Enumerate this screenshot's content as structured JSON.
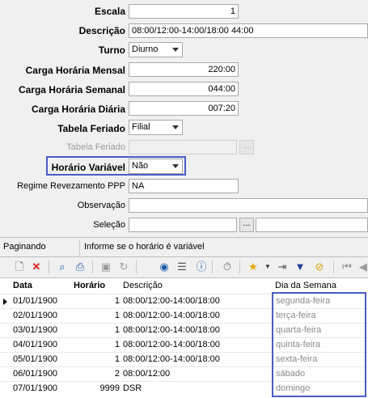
{
  "form": {
    "escala": {
      "label": "Escala",
      "value": "1"
    },
    "descricao": {
      "label": "Descrição",
      "value": "08:00/12:00-14:00/18:00  44:00"
    },
    "turno": {
      "label": "Turno",
      "value": "Diurno"
    },
    "carga_mensal": {
      "label": "Carga Horária Mensal",
      "value": "220:00"
    },
    "carga_semanal": {
      "label": "Carga Horária Semanal",
      "value": "044:00"
    },
    "carga_diaria": {
      "label": "Carga Horária Diária",
      "value": "007:20"
    },
    "tabela_feriado": {
      "label": "Tabela Feriado",
      "value": "Filial"
    },
    "tabela_feriado_2": {
      "label": "Tabela Feriado",
      "value": "",
      "button": "..."
    },
    "horario_variavel": {
      "label": "Horário Variável",
      "value": "Não"
    },
    "regime": {
      "label": "Regime Revezamento PPP",
      "value": "NA"
    },
    "observacao": {
      "label": "Observação",
      "value": ""
    },
    "selecao": {
      "label": "Seleção",
      "value": "",
      "button": "..."
    }
  },
  "status": {
    "left": "Paginando",
    "right": "Informe se o horário é variável"
  },
  "grid": {
    "columns": [
      "Data",
      "Horário",
      "Descrição",
      "Dia da Semana"
    ],
    "rows": [
      {
        "data": "01/01/1900",
        "horario": "1",
        "descricao": "08:00/12:00-14:00/18:00",
        "dia": "segunda-feira"
      },
      {
        "data": "02/01/1900",
        "horario": "1",
        "descricao": "08:00/12:00-14:00/18:00",
        "dia": "terça-feira"
      },
      {
        "data": "03/01/1900",
        "horario": "1",
        "descricao": "08:00/12:00-14:00/18:00",
        "dia": "quarta-feira"
      },
      {
        "data": "04/01/1900",
        "horario": "1",
        "descricao": "08:00/12:00-14:00/18:00",
        "dia": "quinta-feira"
      },
      {
        "data": "05/01/1900",
        "horario": "1",
        "descricao": "08:00/12:00-14:00/18:00",
        "dia": "sexta-feira"
      },
      {
        "data": "06/01/1900",
        "horario": "2",
        "descricao": "08:00/12:00",
        "dia": "sábado"
      },
      {
        "data": "07/01/1900",
        "horario": "9999",
        "descricao": "DSR",
        "dia": "domingo"
      }
    ]
  },
  "colors": {
    "highlight": "#4b5cc4"
  }
}
